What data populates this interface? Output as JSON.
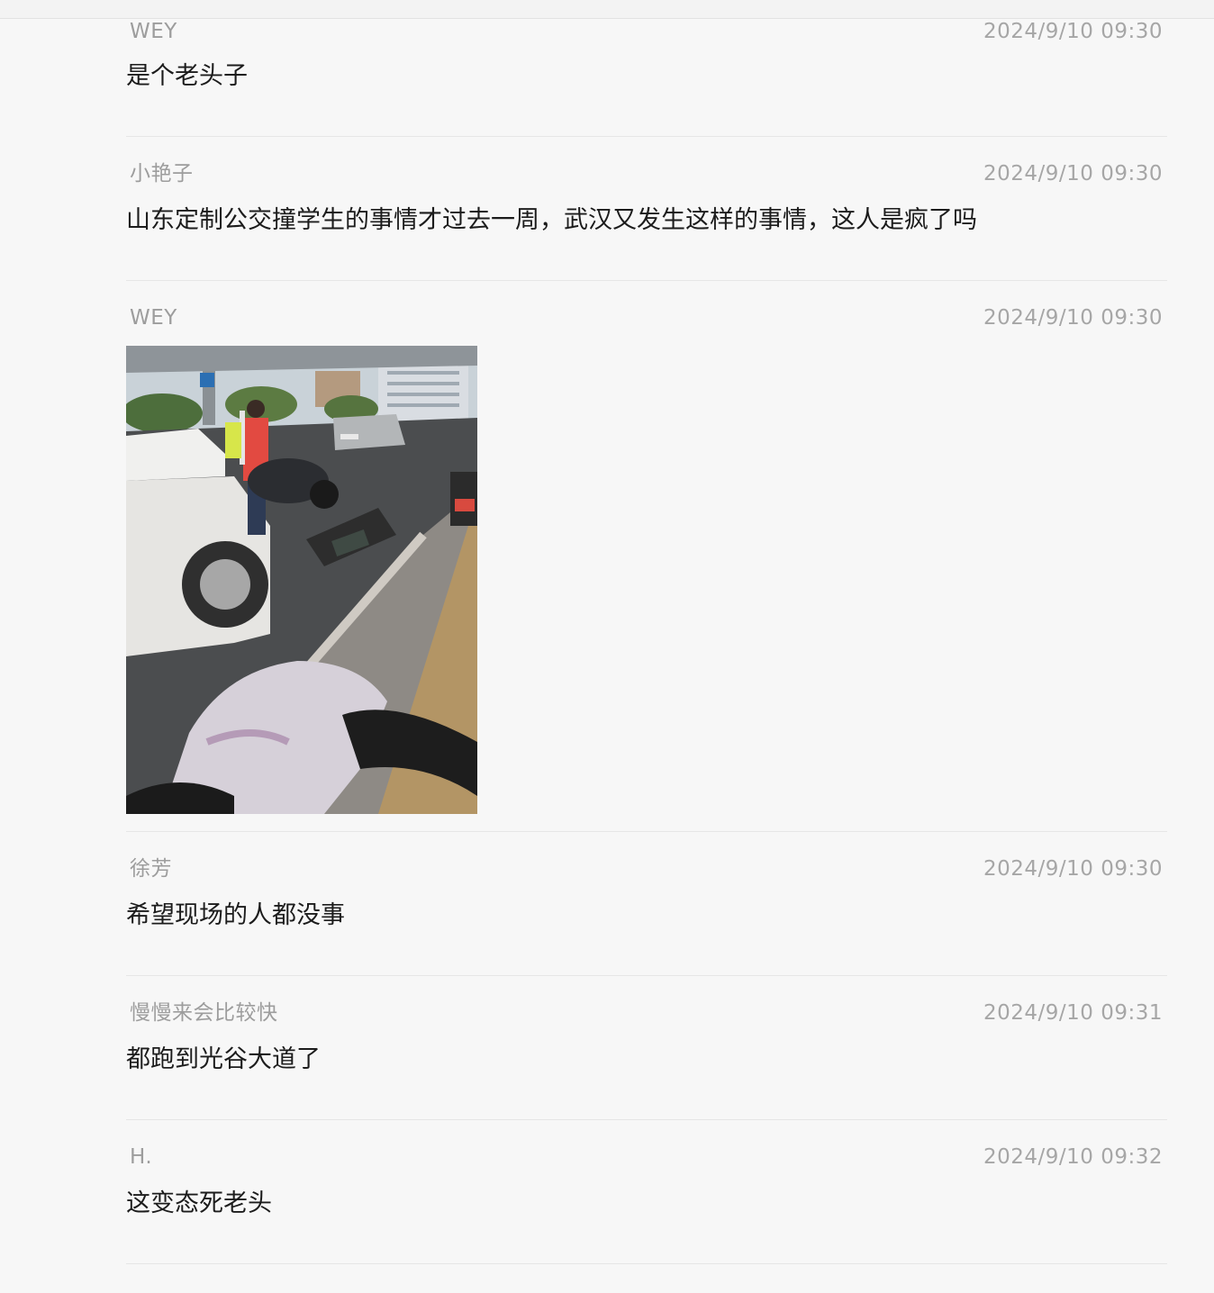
{
  "messages": [
    {
      "sender": "WEY",
      "time": "2024/9/10 09:30",
      "text": "是个老头子"
    },
    {
      "sender": "小艳子",
      "time": "2024/9/10 09:30",
      "text": "山东定制公交撞学生的事情才过去一周，武汉又发生这样的事情，这人是疯了吗"
    },
    {
      "sender": "WEY",
      "time": "2024/9/10 09:30",
      "image": "street-accident-photo"
    },
    {
      "sender": "徐芳",
      "time": "2024/9/10 09:30",
      "text": "希望现场的人都没事"
    },
    {
      "sender": "慢慢来会比较快",
      "time": "2024/9/10 09:31",
      "text": "都跑到光谷大道了"
    },
    {
      "sender": "H.",
      "time": "2024/9/10 09:32",
      "text": "这变态死老头"
    }
  ]
}
